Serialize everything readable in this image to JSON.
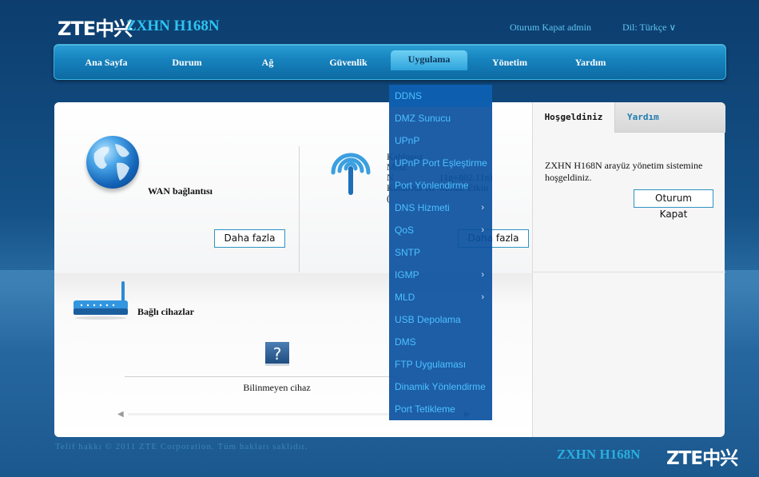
{
  "header": {
    "logo": "ZTE中兴",
    "model": "ZXHN H168N",
    "logout": "Oturum Kapat  admin",
    "language": "Dil: Türkçe  ∨"
  },
  "nav": {
    "items": [
      "Ana Sayfa",
      "Durum",
      "Ağ",
      "Güvenlik",
      "Uygulama",
      "Yönetim",
      "Yardım"
    ],
    "active": "Uygulama"
  },
  "main": {
    "wan": {
      "title": "WAN bağlantısı",
      "more": "Daha fazla"
    },
    "wlan": {
      "line1": "Kablosuz",
      "line2": "Mod:",
      "line3": "N                   11g+802.11n)",
      "line4": "Kablosuz RF Modu: Etkin",
      "line5": "(",
      "more": "Daha fazla"
    },
    "devices": {
      "title": "Bağlı cihazlar",
      "unknown_icon": "?",
      "unknown_label": "Bilinmeyen cihaz",
      "scroll_left": "◀",
      "scroll_right": "▶"
    }
  },
  "side": {
    "tab_welcome": "Hoşgeldiniz",
    "tab_help": "Yardım",
    "welcome_text": "ZXHN H168N arayüz yönetim sistemine hoşgeldiniz.",
    "logout_button": "Oturum Kapat"
  },
  "dropdown": {
    "items": [
      {
        "label": "DDNS",
        "sub": ""
      },
      {
        "label": "DMZ Sunucu",
        "sub": ""
      },
      {
        "label": "UPnP",
        "sub": ""
      },
      {
        "label": "UPnP Port Eşleştirme",
        "sub": ""
      },
      {
        "label": "Port Yönlendirme",
        "sub": ""
      },
      {
        "label": "DNS Hizmeti",
        "sub": "›"
      },
      {
        "label": "QoS",
        "sub": "›"
      },
      {
        "label": "SNTP",
        "sub": ""
      },
      {
        "label": "IGMP",
        "sub": "›"
      },
      {
        "label": "MLD",
        "sub": "›"
      },
      {
        "label": "USB Depolama",
        "sub": ""
      },
      {
        "label": "DMS",
        "sub": ""
      },
      {
        "label": "FTP Uygulaması",
        "sub": ""
      },
      {
        "label": "Dinamik Yönlendirme",
        "sub": ""
      },
      {
        "label": "Port Tetikleme",
        "sub": ""
      }
    ]
  },
  "footer": {
    "copyright": "Telif hakkı © 2011 ZTE Corporation. Tüm hakları saklıdır.",
    "model": "ZXHN H168N",
    "logo": "ZTE中兴"
  },
  "colors": {
    "accent": "#2ec3f0",
    "nav": "#1784bf",
    "dropdown": "#0a50a0",
    "dropdown_text": "#4ec0ff"
  }
}
